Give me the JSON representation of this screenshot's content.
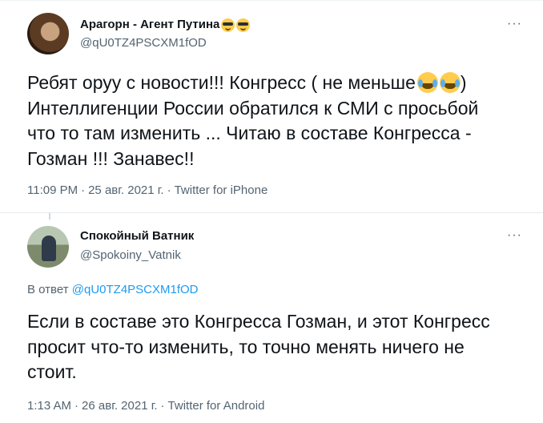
{
  "tweet1": {
    "display_name": "Арагорн - Агент Путина",
    "name_emoji": "smiling-face-with-sunglasses",
    "handle": "@qU0TZ4PSCXM1fOD",
    "more": "···",
    "text_before_emoji": "Ребят оруу с новости!!! Конгресс ( не меньше",
    "text_emoji": "face-with-tears-of-joy",
    "text_after_emoji": ")\nИнтеллигенции России обратился к СМИ с просьбой\nчто то там изменить ... Читаю в составе Конгресса -\nГозман !!! Занавес!!",
    "time": "11:09 PM",
    "date": "25 авг. 2021 г.",
    "source": "Twitter for iPhone",
    "separator": "·"
  },
  "tweet2": {
    "display_name": "Спокойный Ватник",
    "handle": "@Spokoiny_Vatnik",
    "more": "···",
    "reply_prefix": "В ответ",
    "reply_handle": "@qU0TZ4PSCXM1fOD",
    "text": "Если в составе это Конгресса Гозман, и этот Конгресс\nпросит что-то изменить, то точно менять ничего не\nстоит.",
    "time": "1:13 AM",
    "date": "26 авг. 2021 г.",
    "source": "Twitter for Android",
    "separator": "·"
  },
  "colors": {
    "text": "#0f1419",
    "secondary": "#536471",
    "link": "#1d9bf0",
    "divider": "#e6ecf0"
  }
}
